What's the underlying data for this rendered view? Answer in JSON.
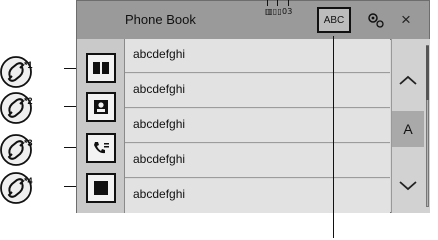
{
  "header": {
    "title": "Phone Book",
    "status_text": "▥▯▯03",
    "abc_label": "ABC",
    "settings_icon": "gear-icon",
    "close_glyph": "×"
  },
  "left_buttons": [
    {
      "icon": "phonebook-icon"
    },
    {
      "icon": "contact-icon"
    },
    {
      "icon": "call-history-icon"
    },
    {
      "icon": "keypad-icon"
    }
  ],
  "contacts": [
    {
      "name": "abcdefghi"
    },
    {
      "name": "abcdefghi"
    },
    {
      "name": "abcdefghi"
    },
    {
      "name": "abcdefghi"
    },
    {
      "name": "abcdefghi"
    }
  ],
  "index": {
    "current_letter": "A"
  },
  "callouts": [
    {
      "mark": "*1"
    },
    {
      "mark": "*2"
    },
    {
      "mark": "*3"
    },
    {
      "mark": "*4"
    }
  ]
}
